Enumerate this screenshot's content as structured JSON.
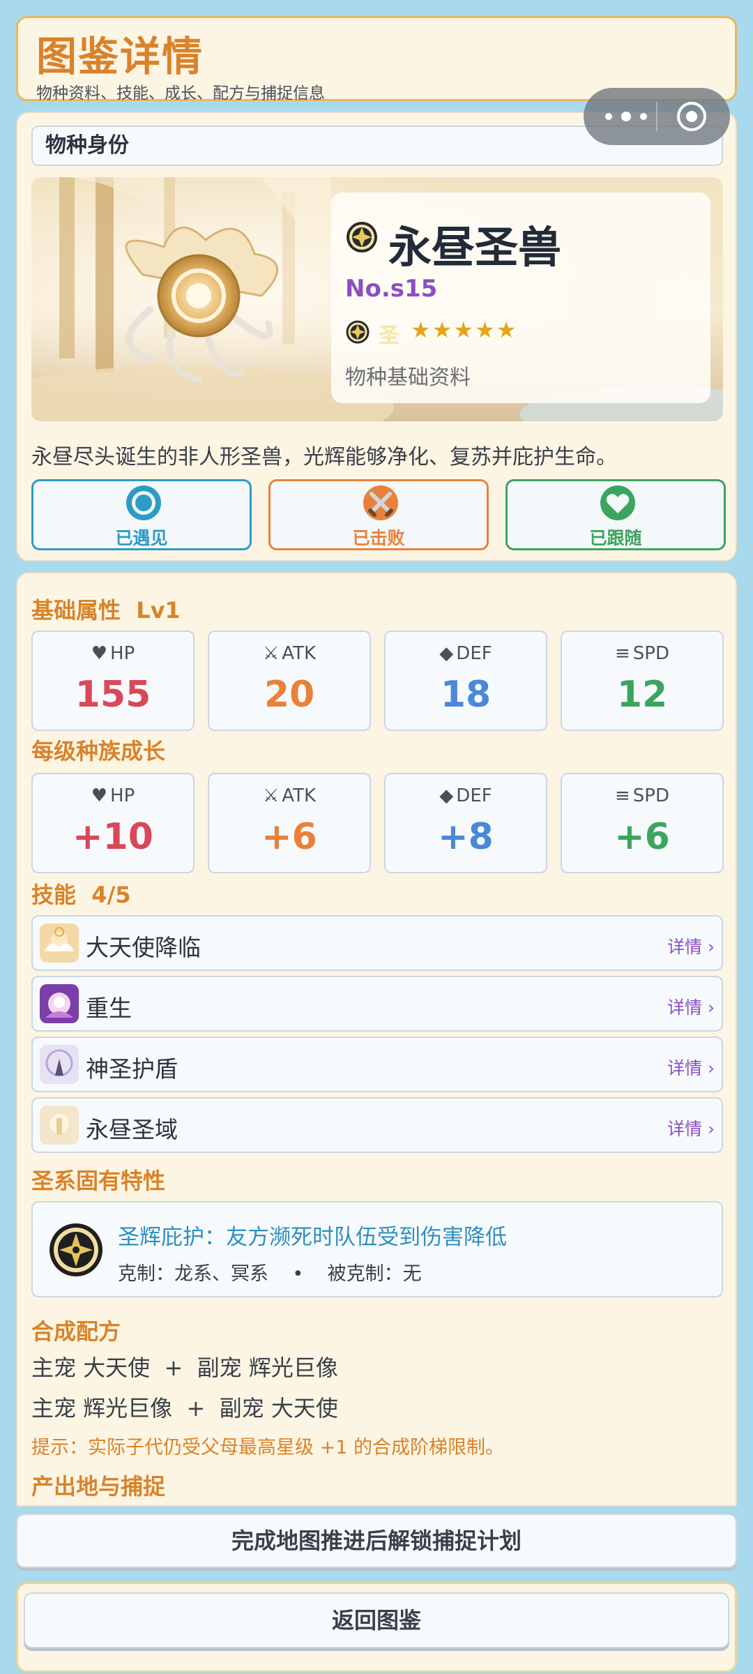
{
  "header": {
    "title": "图鉴详情",
    "subtitle": "物种资料、技能、成长、配方与捕捉信息"
  },
  "identity": {
    "section_title": "物种身份",
    "name": "永昼圣兽",
    "number": "No.s15",
    "element": "圣",
    "stars": "★★★★★",
    "basic_label": "物种基础资料",
    "description": "永昼尽头诞生的非人形圣兽，光辉能够净化、复苏并庇护生命。",
    "status": [
      {
        "label": "已遇见",
        "icon": "ring-icon"
      },
      {
        "label": "已击败",
        "icon": "crossed-swords-icon"
      },
      {
        "label": "已跟随",
        "icon": "heart-icon"
      }
    ]
  },
  "base_stats": {
    "title": "基础属性",
    "level": "Lv1",
    "hp_label": "HP",
    "hp": "155",
    "atk_label": "ATK",
    "atk": "20",
    "def_label": "DEF",
    "def": "18",
    "spd_label": "SPD",
    "spd": "12"
  },
  "growth": {
    "title": "每级种族成长",
    "hp_label": "HP",
    "hp": "+10",
    "atk_label": "ATK",
    "atk": "+6",
    "def_label": "DEF",
    "def": "+8",
    "spd_label": "SPD",
    "spd": "+6"
  },
  "skills": {
    "title": "技能",
    "count": "4/5",
    "detail_label": "详情 ›",
    "items": [
      {
        "name": "大天使降临"
      },
      {
        "name": "重生"
      },
      {
        "name": "神圣护盾"
      },
      {
        "name": "永昼圣域"
      }
    ]
  },
  "trait": {
    "title": "圣系固有特性",
    "name": "圣辉庇护：友方濒死时队伍受到伤害降低",
    "counter": "克制：龙系、冥系    •    被克制：无"
  },
  "recipe": {
    "title": "合成配方",
    "lines": [
      "主宠 大天使  +  副宠 辉光巨像",
      "主宠 辉光巨像  +  副宠 大天使"
    ],
    "tip": "提示：实际子代仍受父母最高星级 +1 的合成阶梯限制。"
  },
  "capture": {
    "title": "产出地与捕捉",
    "unlock_button": "完成地图推进后解锁捕捉计划"
  },
  "footer": {
    "back_button": "返回图鉴"
  },
  "colors": {
    "accent": "#d8832b",
    "hp": "#d9485a",
    "atk": "#e9813a",
    "def": "#4a88d8",
    "spd": "#3ba55f",
    "purple": "#8a4fc4",
    "background": "#a9d9ec"
  }
}
